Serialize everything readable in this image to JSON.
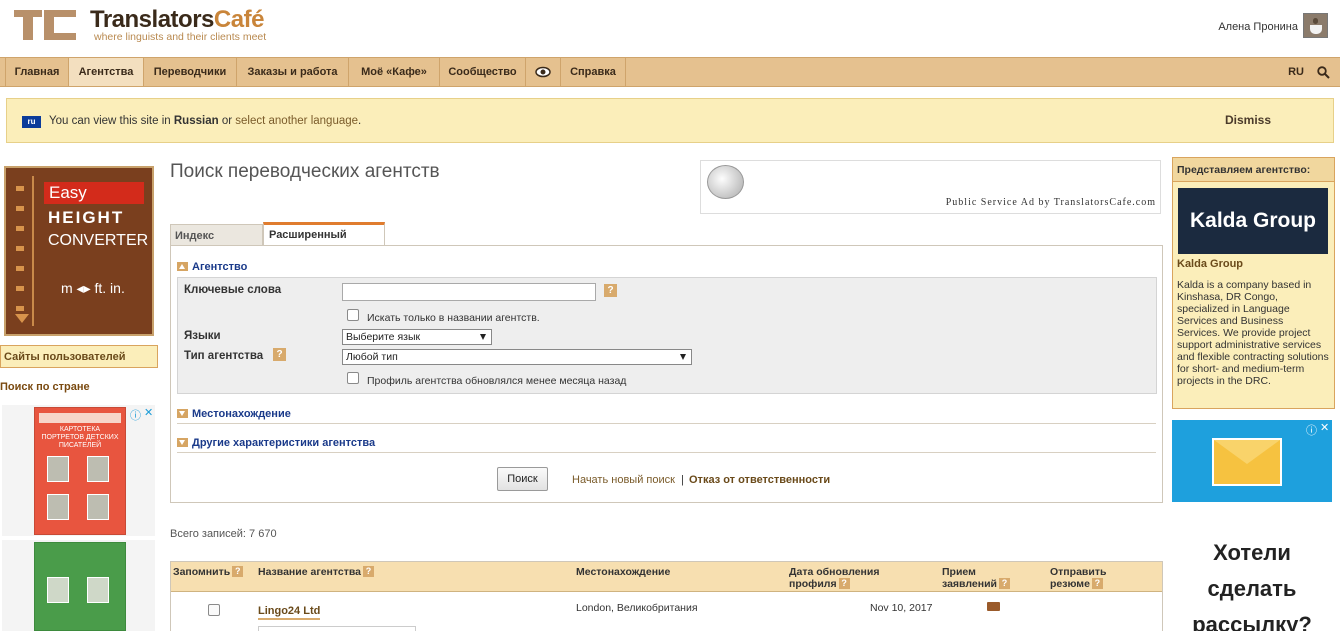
{
  "header": {
    "brand_main": "Translators",
    "brand_accent": "Café",
    "tagline": "where linguists and their clients meet",
    "user_name": "Алена Пронина"
  },
  "nav": {
    "items": [
      {
        "label": "Главная"
      },
      {
        "label": "Агентства",
        "active": true
      },
      {
        "label": "Переводчики"
      },
      {
        "label": "Заказы и работа"
      },
      {
        "label": "Моё «Кафе»"
      },
      {
        "label": "Сообщество"
      },
      {
        "label": ""
      },
      {
        "label": "Справка"
      }
    ],
    "language": "RU"
  },
  "notice": {
    "flag": "ru",
    "text_before": "You can view this site in",
    "language": "Russian",
    "text_or": "or",
    "link": "select another language",
    "dismiss": "Dismiss"
  },
  "left": {
    "ad": {
      "easy": "Easy",
      "height": "HEIGHT",
      "converter": "CONVERTER",
      "units": "m ◂▸ ft. in."
    },
    "user_sites": "Сайты пользователей",
    "country_search": "Поиск по стране"
  },
  "main": {
    "title": "Поиск переводческих агентств",
    "psa": "Public Service Ad by TranslatorsCafe.com",
    "tabs": {
      "index": "Индекс",
      "advanced": "Расширенный"
    },
    "sections": {
      "agency": "Агентство",
      "location": "Местонахождение",
      "other": "Другие характеристики агентства"
    },
    "form": {
      "keywords_label": "Ключевые слова",
      "keywords_value": "",
      "name_only_label": "Искать только в названии агентств.",
      "languages_label": "Языки",
      "languages_value": "Выберите язык",
      "type_label": "Тип агентства",
      "type_value": "Любой тип",
      "recent_label": "Профиль агентства обновлялся менее месяца назад",
      "help": "?"
    },
    "actions": {
      "search": "Поиск",
      "new_search": "Начать новый поиск",
      "separator": "|",
      "disclaimer": "Отказ от ответственности"
    },
    "total_label": "Всего записей:",
    "total_value": "7 670",
    "table": {
      "headers": {
        "remember": "Запомнить",
        "name": "Название агентства",
        "location": "Местонахождение",
        "updated_1": "Дата обновления",
        "updated_2": "профиля",
        "accept_1": "Прием",
        "accept_2": "заявлений",
        "send_1": "Отправить",
        "send_2": "резюме"
      },
      "rows": [
        {
          "name": "Lingo24 Ltd",
          "location": "London, Великобритания",
          "date": "Nov 10, 2017"
        }
      ]
    }
  },
  "right": {
    "featured_title": "Представляем агентство:",
    "logo_text": "Kalda Group",
    "name": "Kalda Group",
    "description": "Kalda is a company based in Kinshasa, DR Congo, specialized in Language Services and Business Services. We provide project support administrative services and flexible contracting solutions for short- and medium-term projects in the DRC.",
    "promo": "Хотели сделать рассылку?"
  }
}
